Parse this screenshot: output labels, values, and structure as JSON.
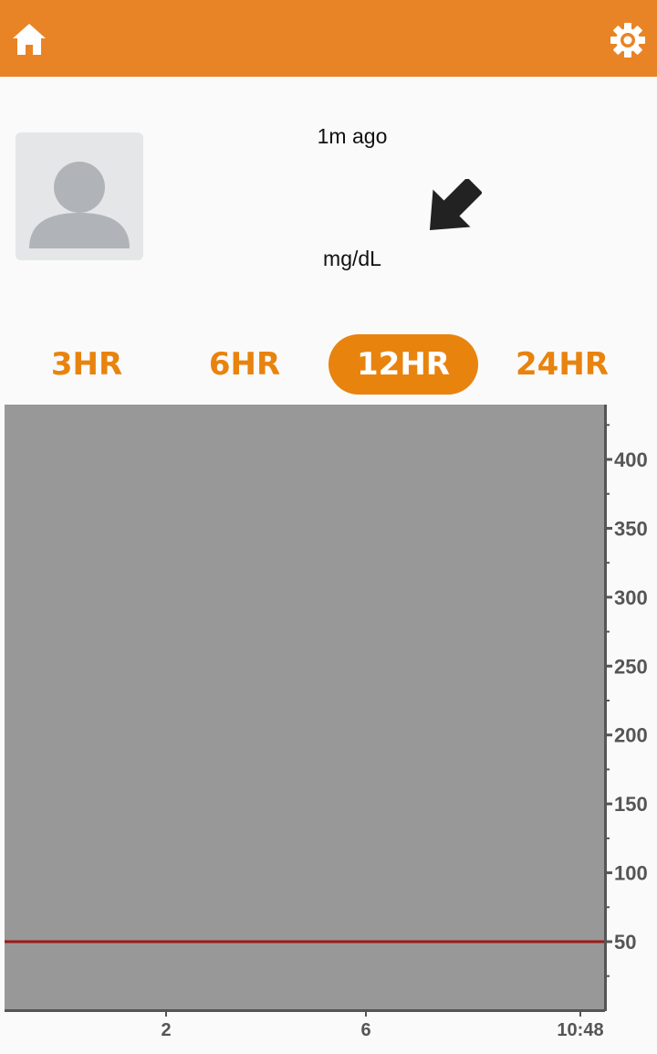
{
  "header": {
    "home_icon": "home-icon",
    "settings_icon": "gear-icon",
    "color": "#e88425"
  },
  "reading": {
    "last_updated": "1m ago",
    "units": "mg/dL",
    "trend_icon": "arrow-down-right-icon"
  },
  "avatar_icon": "person-icon",
  "ranges": {
    "options": [
      "3HR",
      "6HR",
      "12HR",
      "24HR"
    ],
    "selected": "12HR",
    "accent": "#e8830e"
  },
  "chart_data": {
    "type": "line",
    "x_tick_labels": [
      "2",
      "6",
      "10:48"
    ],
    "y_ticks": [
      50,
      100,
      150,
      200,
      250,
      300,
      350,
      400
    ],
    "ylim": [
      10,
      440
    ],
    "grid": false,
    "reference_lines": [
      {
        "y": 50,
        "color": "#a01818"
      }
    ],
    "series": [],
    "plot_background": "#989898"
  }
}
